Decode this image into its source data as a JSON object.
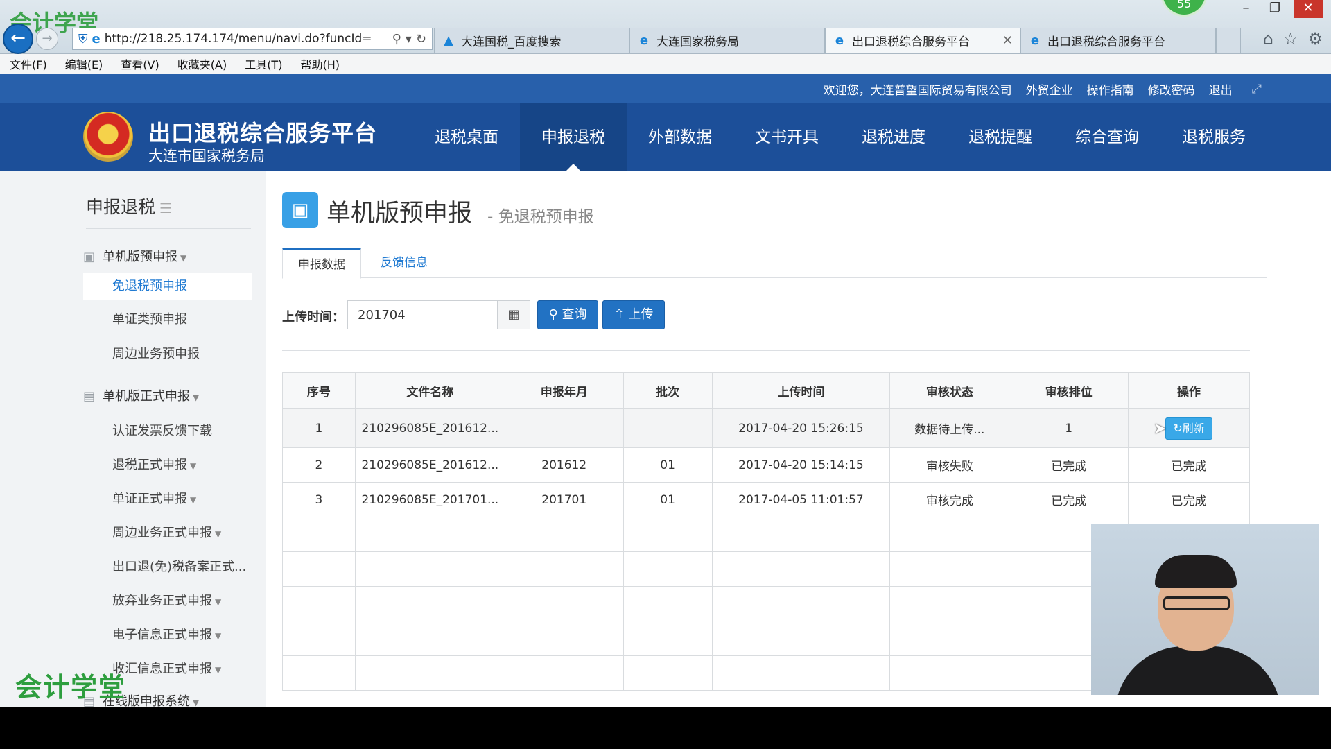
{
  "browser": {
    "url": "http://218.25.174.174/menu/navi.do?funcId=",
    "tabs": [
      {
        "label": "大连国税_百度搜索",
        "icon": "baidu-icon",
        "active": false
      },
      {
        "label": "大连国家税务局",
        "icon": "ie-icon",
        "active": false
      },
      {
        "label": "出口退税综合服务平台",
        "icon": "ie-icon",
        "active": true,
        "closable": true
      },
      {
        "label": "出口退税综合服务平台",
        "icon": "ie-icon",
        "active": false
      }
    ],
    "badge_count": "55",
    "menu": [
      "文件(F)",
      "编辑(E)",
      "查看(V)",
      "收藏夹(A)",
      "工具(T)",
      "帮助(H)"
    ]
  },
  "topbar": {
    "welcome": "欢迎您，大连普望国际贸易有限公司",
    "company_type": "外贸企业",
    "guide": "操作指南",
    "change_password": "修改密码",
    "logout": "退出"
  },
  "site": {
    "title": "出口退税综合服务平台",
    "subtitle": "大连市国家税务局"
  },
  "mainnav": [
    "退税桌面",
    "申报退税",
    "外部数据",
    "文书开具",
    "退税进度",
    "退税提醒",
    "综合查询",
    "退税服务"
  ],
  "mainnav_active": "申报退税",
  "sidebar": {
    "title": "申报退税",
    "items": [
      {
        "label": "单机版预申报",
        "type": "group"
      },
      {
        "label": "免退税预申报",
        "type": "selected"
      },
      {
        "label": "单证类预申报",
        "type": "sub"
      },
      {
        "label": "周边业务预申报",
        "type": "sub"
      },
      {
        "label": "单机版正式申报",
        "type": "group"
      },
      {
        "label": "认证发票反馈下载",
        "type": "sub"
      },
      {
        "label": "退税正式申报",
        "type": "sub"
      },
      {
        "label": "单证正式申报",
        "type": "sub"
      },
      {
        "label": "周边业务正式申报",
        "type": "sub"
      },
      {
        "label": "出口退(免)税备案正式...",
        "type": "sub"
      },
      {
        "label": "放弃业务正式申报",
        "type": "sub"
      },
      {
        "label": "电子信息正式申报",
        "type": "sub"
      },
      {
        "label": "收汇信息正式申报",
        "type": "sub"
      },
      {
        "label": "在线版申报系统",
        "type": "group"
      }
    ]
  },
  "page": {
    "title": "单机版预申报",
    "subtitle": "- 免退税预申报",
    "tabs": [
      "申报数据",
      "反馈信息"
    ],
    "filter_label": "上传时间：",
    "filter_value": "201704",
    "query_button": "查询",
    "upload_button": "上传"
  },
  "table": {
    "headers": [
      "序号",
      "文件名称",
      "申报年月",
      "批次",
      "上传时间",
      "审核状态",
      "审核排位",
      "操作"
    ],
    "rows": [
      [
        "1",
        "210296085E_201612...",
        "",
        "",
        "2017-04-20 15:26:15",
        "数据待上传...",
        "1",
        "刷新"
      ],
      [
        "2",
        "210296085E_201612...",
        "201612",
        "01",
        "2017-04-20 15:14:15",
        "审核失败",
        "已完成",
        "已完成"
      ],
      [
        "3",
        "210296085E_201701...",
        "201701",
        "01",
        "2017-04-05 11:01:57",
        "审核完成",
        "已完成",
        "已完成"
      ]
    ]
  },
  "watermark": "会计学堂"
}
